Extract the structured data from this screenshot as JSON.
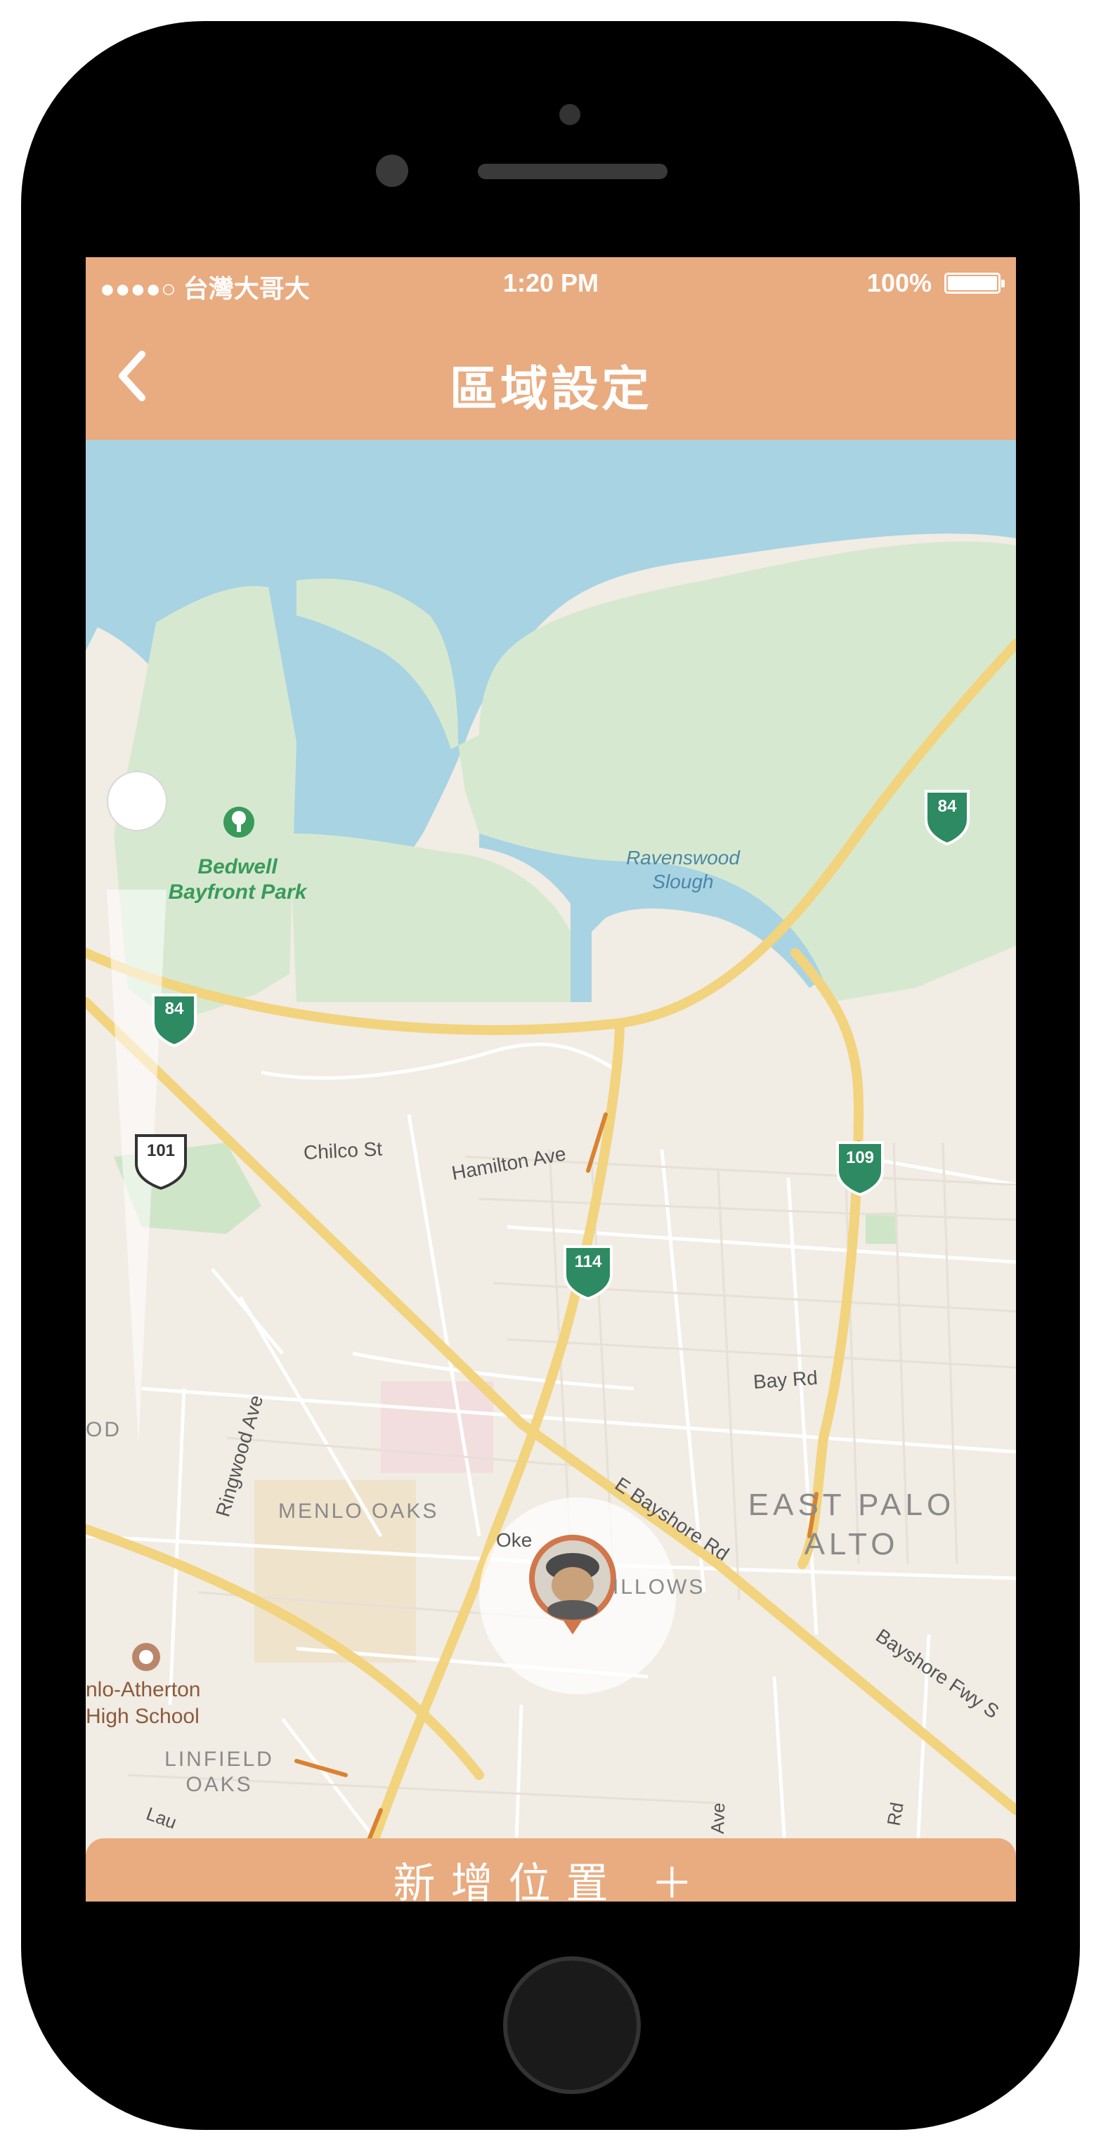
{
  "status_bar": {
    "carrier": "●●●●○ 台灣大哥大",
    "time": "1:20 PM",
    "battery": "100%"
  },
  "nav": {
    "back_icon": "chevron-left-icon",
    "title": "區域設定"
  },
  "map": {
    "labels": {
      "park": "Bedwell\nBayfront Park",
      "slough": "Ravenswood\nSlough",
      "hwy84_top": "84",
      "hwy84_left": "84",
      "hwy101": "101",
      "hwy109": "109",
      "hwy114": "114",
      "chilco": "Chilco St",
      "hamilton": "Hamilton Ave",
      "bay_rd": "Bay Rd",
      "ringwood": "Ringwood Ave",
      "od": "OD",
      "menlo_oaks": "MENLO OAKS",
      "east_palo_alto": "EAST PALO\nALTO",
      "e_bayshore": "E Bayshore Rd",
      "bayshore_fwy": "Bayshore Fwy S",
      "oke": "Oke",
      "willows": "ILLOWS",
      "school": "nlo-Atherton\nHigh School",
      "linfield": "LINFIELD\nOAKS",
      "lau": "Lau",
      "ave": "Ave",
      "rd": "Rd"
    },
    "colors": {
      "water": "#a8d3e3",
      "park": "#d6e9d0",
      "land": "#f1ece4",
      "highway": "#f2d37e",
      "accent": "#e9ab80"
    }
  },
  "user_pin": {
    "icon": "user-avatar-pin-icon",
    "radius_icon": "range-circle"
  },
  "actions": {
    "add_location": "新增位置 ＋"
  }
}
